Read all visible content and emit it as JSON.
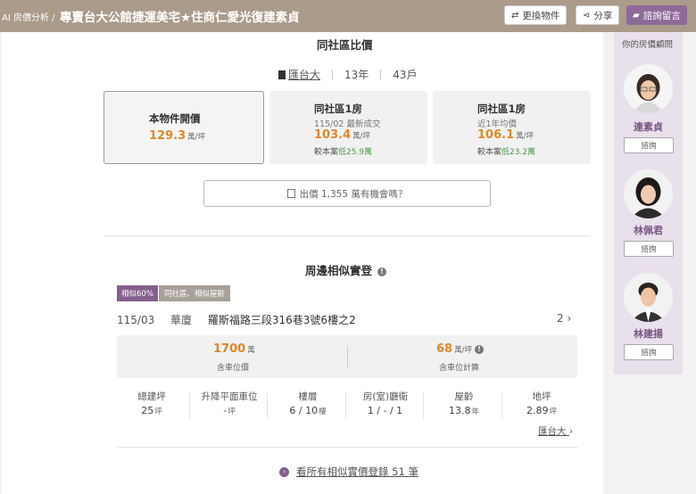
{
  "topbar": {
    "breadcrumb": "AI 房價分析 /",
    "title": "專賣台大公館捷運美宅★住商仁愛光復建素貞",
    "btn_change": "更換物件",
    "btn_share": "分享",
    "btn_consult": "諮詢留言",
    "icons": [
      "swap-icon",
      "share-icon",
      "chat-icon"
    ]
  },
  "community_compare": {
    "title": "同社區比價",
    "community_name": "匯台大",
    "age": "13年",
    "households": "43戶",
    "cards": [
      {
        "title": "本物件開價",
        "price": "129.3",
        "unit": "萬/坪"
      },
      {
        "title": "同社區1房",
        "subtitle": "115/02 最新成交",
        "price": "103.4",
        "unit": "萬/坪",
        "diff_prefix": "較本案",
        "diff_value": "低25.9萬"
      },
      {
        "title": "同社區1房",
        "subtitle": "近1年均價",
        "price": "106.1",
        "unit": "萬/坪",
        "diff_prefix": "較本案",
        "diff_value": "低23.2萬"
      }
    ],
    "offer_button": "出價 1,355 萬有機會嗎？"
  },
  "similar": {
    "title": "周邊相似實登",
    "tag_similarity": "相似60%",
    "tag_criteria": "同社區、相似屋齡",
    "date": "115/03",
    "building_type": "華廈",
    "address": "羅斯福路三段316巷3號6樓之2",
    "pager": "2",
    "total_price": "1700",
    "total_unit": "萬",
    "total_label": "含車位價",
    "unit_price": "68",
    "unit_price_unit": "萬/坪",
    "unit_price_label": "含車位計算",
    "specs": [
      {
        "label": "總建坪",
        "value": "25",
        "unit": "坪"
      },
      {
        "label": "升降平面車位",
        "value": "-",
        "unit": "坪"
      },
      {
        "label": "樓層",
        "value": "6 / 10",
        "unit": "樓"
      },
      {
        "label": "房(室)廳衛",
        "value": "1 / - / 1",
        "unit": ""
      },
      {
        "label": "屋齡",
        "value": "13.8",
        "unit": "年"
      },
      {
        "label": "地坪",
        "value": "2.89",
        "unit": "坪"
      }
    ],
    "community_link": "匯台大",
    "view_all": "看所有相似實價登錄 51 筆"
  },
  "sidebar": {
    "header": "你的房價顧問",
    "consultants": [
      {
        "name": "連素貞",
        "button": "諮詢"
      },
      {
        "name": "林佩君",
        "button": "諮詢"
      },
      {
        "name": "林建揚",
        "button": "諮詢"
      }
    ]
  },
  "colors": {
    "accent": "#84608d",
    "price": "#e0882a",
    "positive": "#4a9a4a",
    "topbar": "#aa9b8a"
  }
}
